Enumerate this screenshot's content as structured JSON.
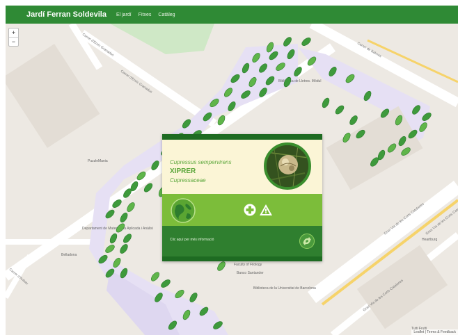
{
  "app": {
    "brand": "Jardí Ferran Soldevila",
    "nav": [
      "El jardí",
      "Fitxes",
      "Catàleg"
    ]
  },
  "map": {
    "zoom_in": "+",
    "zoom_out": "−",
    "street_labels": [
      "Carrer d'Enric Granados",
      "Carrer d'Enric Granados",
      "Carrer de Balmes",
      "Gran Via de les Corts Catalanes",
      "Gran Via de les Corts Catalanes",
      "Gran Via de les Corts Catalanes",
      "Carrer d'Aribau"
    ],
    "poi_labels": [
      "Biblioteca de Lletres. Mòdul",
      "PuzzleMania",
      "Departament de Matemàtica Aplicada i Anàlisi",
      "Belladona",
      "Faculty of Filology",
      "Banco Santander",
      "Biblioteca de la Universitat de Barcelona",
      "Heartburg",
      "Tutti Frutti"
    ],
    "attribution": "Leaflet | Terms & Feedback"
  },
  "popup": {
    "scientific_name": "Cupressus sempervirens",
    "common_name": "XIPRER",
    "family": "Cupressaceae",
    "more_info": "Clic aquí per més informació",
    "icons": [
      "globe-icon",
      "plus-icon",
      "warning-icon",
      "link-icon"
    ]
  },
  "colors": {
    "navbar": "#2f8a35",
    "popup_light": "#fbf5d6",
    "popup_mid": "#7cbd3a",
    "popup_dark": "#1e6b22",
    "leaf": "#3e9a3c"
  }
}
